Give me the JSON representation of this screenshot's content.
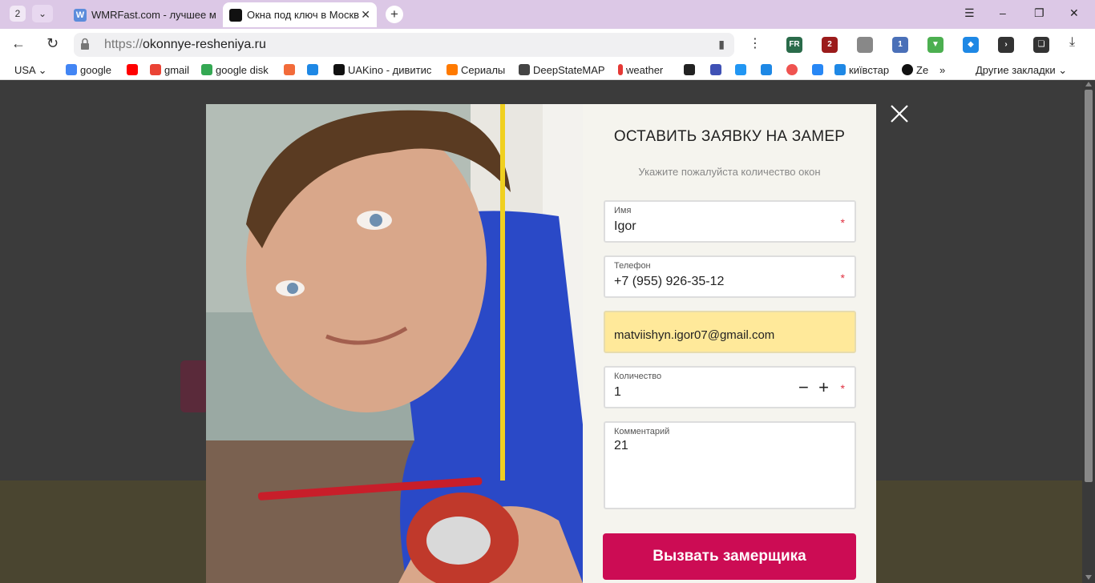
{
  "browser": {
    "tab_count": "2",
    "tabs": [
      {
        "title": "WMRFast.com - лучшее м",
        "favicon": "W",
        "favicon_color": "#5b8cdb"
      },
      {
        "title": "Окна под ключ в Москв",
        "favicon": "",
        "favicon_color": "#111111"
      }
    ],
    "url_protocol": "https://",
    "url_host": "okonnye-resheniya.ru",
    "extensions": [
      {
        "name": "fr-extension-icon",
        "label": "FR",
        "color": "#2a6b4a"
      },
      {
        "name": "ublock-icon",
        "label": "2",
        "color": "#9b1b1b"
      },
      {
        "name": "extension-puzzle-icon",
        "label": "",
        "color": "#888888"
      },
      {
        "name": "extension-counter-icon",
        "label": "1",
        "color": "#4a70b8"
      },
      {
        "name": "download-arrow-icon",
        "label": "",
        "color": "#4caf50"
      },
      {
        "name": "diamond-icon",
        "label": "",
        "color": "#1e88e5"
      },
      {
        "name": "reader-icon",
        "label": "",
        "color": "#333333"
      },
      {
        "name": "collection-icon",
        "label": "",
        "color": "#333333"
      }
    ]
  },
  "bookmarks": [
    {
      "label": "USA ⌄",
      "color": ""
    },
    {
      "label": "google",
      "color": "#4285f4"
    },
    {
      "label": "",
      "color": "#ff0000"
    },
    {
      "label": "gmail",
      "color": "#ea4335"
    },
    {
      "label": "google disk",
      "color": "#34a853"
    },
    {
      "label": "",
      "color": "#f26b3a"
    },
    {
      "label": "",
      "color": "#1e88e5"
    },
    {
      "label": "UAKino - дивитис",
      "color": "#111111"
    },
    {
      "label": "Сериалы",
      "color": "#ff7a00"
    },
    {
      "label": "DeepStateMAP",
      "color": "#444444"
    },
    {
      "label": "weather",
      "color": "#e53935"
    },
    {
      "label": "",
      "color": "#222222"
    },
    {
      "label": "",
      "color": "#3f51b5"
    },
    {
      "label": "",
      "color": "#2196f3"
    },
    {
      "label": "",
      "color": "#1e88e5"
    },
    {
      "label": "",
      "color": "#ef5350"
    },
    {
      "label": "",
      "color": "#2787f5"
    },
    {
      "label": "київстар",
      "color": "#1e88e5"
    },
    {
      "label": "Ze",
      "color": "#111111"
    }
  ],
  "bookmarks_more": "»",
  "other_bookmarks": "Другие закладки ⌄",
  "form": {
    "title": "ОСТАВИТЬ ЗАЯВКУ НА ЗАМЕР",
    "subtitle": "Укажите пожалуйста количество окон",
    "name_label": "Имя",
    "name_value": "Igor",
    "phone_label": "Телефон",
    "phone_value": "+7 (955) 926-35-12",
    "email_value": "matviishyn.igor07@gmail.com",
    "qty_label": "Количество",
    "qty_value": "1",
    "comment_label": "Комментарий",
    "comment_value": "21",
    "required_mark": "*",
    "submit_label": "Вызвать замерщика"
  },
  "colors": {
    "accent": "#cc0c54",
    "autofill": "#ffe99a",
    "required": "#e03040"
  }
}
